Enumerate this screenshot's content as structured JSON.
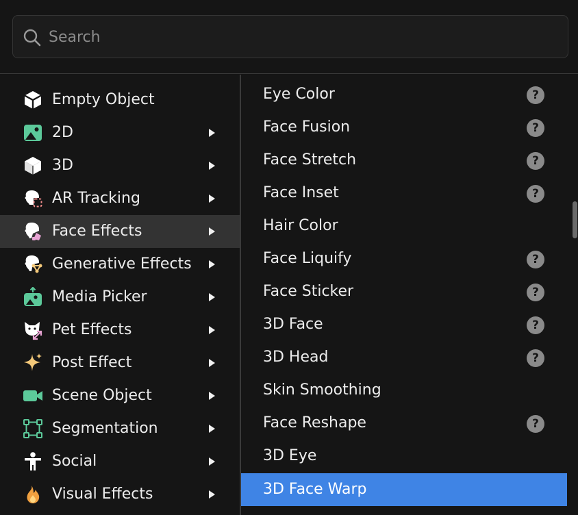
{
  "search": {
    "placeholder": "Search",
    "value": ""
  },
  "categories": [
    {
      "label": "Empty Object",
      "icon": "cube-outline-icon",
      "has_submenu": false
    },
    {
      "label": "2D",
      "icon": "image-icon",
      "has_submenu": true
    },
    {
      "label": "3D",
      "icon": "cube-icon",
      "has_submenu": true
    },
    {
      "label": "AR Tracking",
      "icon": "ar-tracking-icon",
      "has_submenu": true
    },
    {
      "label": "Face Effects",
      "icon": "face-effects-icon",
      "has_submenu": true,
      "active": true
    },
    {
      "label": "Generative Effects",
      "icon": "generative-effects-icon",
      "has_submenu": true
    },
    {
      "label": "Media Picker",
      "icon": "media-picker-icon",
      "has_submenu": true
    },
    {
      "label": "Pet Effects",
      "icon": "pet-effects-icon",
      "has_submenu": true
    },
    {
      "label": "Post Effect",
      "icon": "sparkle-icon",
      "has_submenu": true
    },
    {
      "label": "Scene Object",
      "icon": "video-camera-icon",
      "has_submenu": true
    },
    {
      "label": "Segmentation",
      "icon": "segmentation-icon",
      "has_submenu": true
    },
    {
      "label": "Social",
      "icon": "person-icon",
      "has_submenu": true
    },
    {
      "label": "Visual Effects",
      "icon": "flame-icon",
      "has_submenu": true
    }
  ],
  "face_effects": [
    {
      "label": "Eye Color",
      "help": true
    },
    {
      "label": "Face Fusion",
      "help": true
    },
    {
      "label": "Face Stretch",
      "help": true
    },
    {
      "label": "Face Inset",
      "help": true
    },
    {
      "label": "Hair Color",
      "help": false
    },
    {
      "label": "Face Liquify",
      "help": true
    },
    {
      "label": "Face Sticker",
      "help": true
    },
    {
      "label": "3D Face",
      "help": true
    },
    {
      "label": "3D Head",
      "help": true
    },
    {
      "label": "Skin Smoothing",
      "help": false
    },
    {
      "label": "Face Reshape",
      "help": true
    },
    {
      "label": "3D Eye",
      "help": false
    },
    {
      "label": "3D Face Warp",
      "help": false,
      "selected": true
    }
  ],
  "help_glyph": "?",
  "colors": {
    "background": "#151515",
    "active_row": "#333333",
    "selected_row": "#3f84e5",
    "icon_green": "#5cc99a",
    "icon_pink": "#e8a4d4",
    "icon_yellow": "#f4c97a",
    "icon_orange": "#f0a040"
  }
}
